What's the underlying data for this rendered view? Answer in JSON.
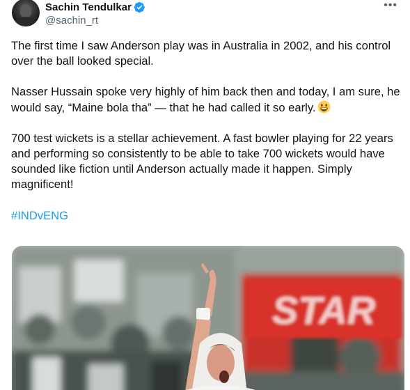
{
  "tweet": {
    "author": {
      "display_name": "Sachin Tendulkar",
      "handle": "@sachin_rt",
      "verified": true,
      "verified_badge_color": "#1d9bf0"
    },
    "more_label": "•••",
    "paragraphs": [
      "The first time I saw Anderson play was in Australia in 2002, and his control over the ball looked special.",
      "Nasser Hussain spoke very highly of him back then and today, I am sure, he would say, “Maine bola tha” — that he had called it so early.",
      "700 test wickets is a stellar achievement. A fast bowler playing for 22 years and performing so consistently to be able to take 700 wickets would have sounded like fiction until Anderson actually made it happen. Simply magnificent!"
    ],
    "hashtag": "#INDvENG",
    "emoji_icon": "grinning-face-emoji",
    "media": {
      "banner_text": "STAR",
      "banner_color": "#d8322c"
    }
  },
  "colors": {
    "text": "#0f1419",
    "secondary": "#536471",
    "link": "#1d9bf0"
  }
}
